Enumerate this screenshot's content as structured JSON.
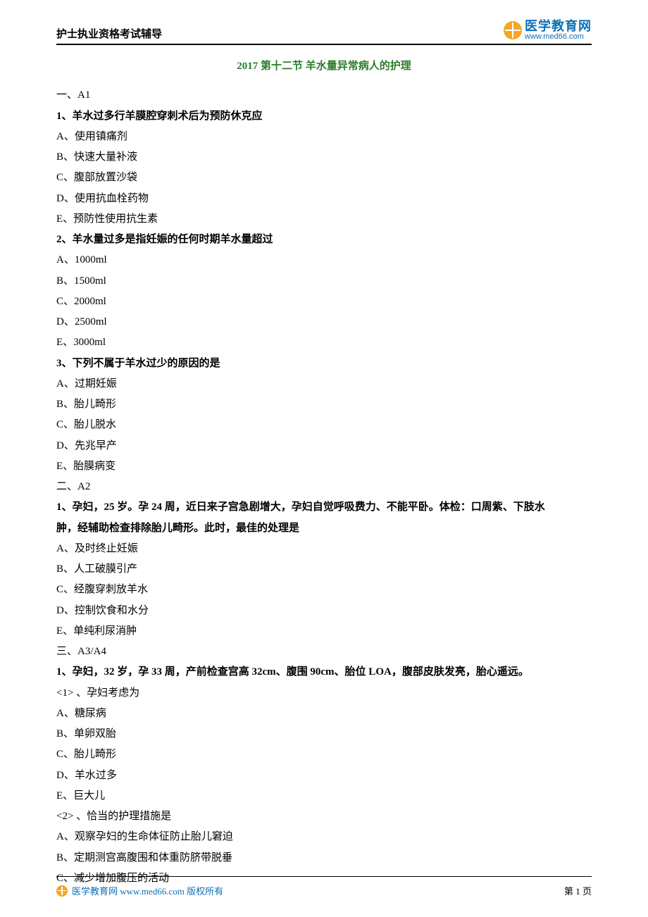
{
  "header": {
    "title": "护士执业资格考试辅导",
    "logo_cn": "医学教育网",
    "logo_url": "www.med66.com"
  },
  "doc_title": "2017 第十二节  羊水量异常病人的护理",
  "sections": {
    "a1": {
      "heading": "一、A1",
      "q1": {
        "stem": "1、羊水过多行羊膜腔穿刺术后为预防休克应",
        "a": "A、使用镇痛剂",
        "b": "B、快速大量补液",
        "c": "C、腹部放置沙袋",
        "d": "D、使用抗血栓药物",
        "e": "E、预防性使用抗生素"
      },
      "q2": {
        "stem": "2、羊水量过多是指妊娠的任何时期羊水量超过",
        "a": "A、1000ml",
        "b": "B、1500ml",
        "c": "C、2000ml",
        "d": "D、2500ml",
        "e": "E、3000ml"
      },
      "q3": {
        "stem": "3、下列不属于羊水过少的原因的是",
        "a": "A、过期妊娠",
        "b": "B、胎儿畸形",
        "c": "C、胎儿脱水",
        "d": "D、先兆早产",
        "e": "E、胎膜病变"
      }
    },
    "a2": {
      "heading": "二、A2",
      "q1": {
        "stem1": "1、孕妇，25 岁。孕 24 周，近日来子宫急剧增大，孕妇自觉呼吸费力、不能平卧。体检：口周紫、下肢水",
        "stem2": "肿，经辅助检查排除胎儿畸形。此时，最佳的处理是",
        "a": "A、及时终止妊娠",
        "b": "B、人工破膜引产",
        "c": "C、经腹穿刺放羊水",
        "d": "D、控制饮食和水分",
        "e": "E、单纯利尿消肿"
      }
    },
    "a3a4": {
      "heading": "三、A3/A4",
      "q1": {
        "stem": "1、孕妇，32 岁，孕 33 周，产前检查宫高 32cm、腹围 90cm、胎位 LOA，腹部皮肤发亮，胎心遥远。",
        "sub1": {
          "label": "<1>  、孕妇考虑为",
          "a": "A、糖尿病",
          "b": "B、单卵双胎",
          "c": "C、胎儿畸形",
          "d": "D、羊水过多",
          "e": "E、巨大儿"
        },
        "sub2": {
          "label": "<2>  、恰当的护理措施是",
          "a": "A、观察孕妇的生命体征防止胎儿窘迫",
          "b": "B、定期测宫高腹围和体重防脐带脱垂",
          "c": "C、减少增加腹压的活动"
        }
      }
    }
  },
  "footer": {
    "text": "医学教育网 www.med66.com 版权所有",
    "page": "第 1 页"
  }
}
